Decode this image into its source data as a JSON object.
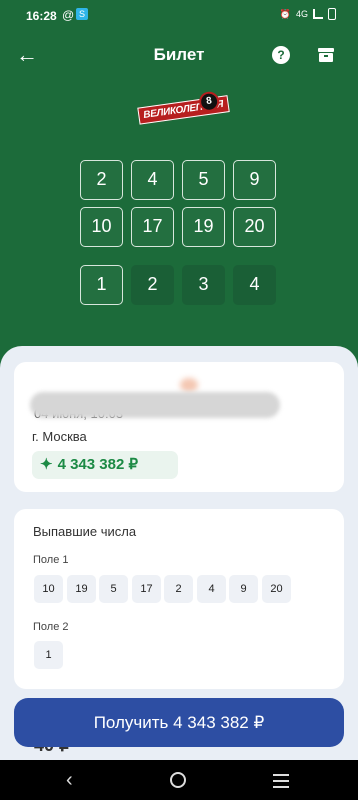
{
  "status": {
    "time": "16:28",
    "network": "4G"
  },
  "app_bar": {
    "title": "Билет",
    "help_label": "?"
  },
  "logo": {
    "text": "ВЕЛИКОЛЕПНАЯ",
    "ball_number": "8"
  },
  "ticket_numbers": [
    "2",
    "4",
    "5",
    "9",
    "10",
    "17",
    "19",
    "20"
  ],
  "ticket_field2": [
    "1",
    "2",
    "3",
    "4"
  ],
  "draw": {
    "date_time": "04 июня, 10:03",
    "city": "г. Москва",
    "prize": "4 343 382 ₽"
  },
  "drawn": {
    "title": "Выпавшие числа",
    "field1_label": "Поле 1",
    "field1_numbers": [
      "10",
      "19",
      "5",
      "17",
      "2",
      "4",
      "9",
      "20"
    ],
    "field2_label": "Поле 2",
    "field2_numbers": [
      "1"
    ]
  },
  "peek_text": "40 ₽",
  "cta_label": "Получить 4 343 382 ₽",
  "colors": {
    "background_green": "#1c6b3a",
    "cta_blue": "#2d4ea3",
    "prize_green": "#1c8a45"
  }
}
